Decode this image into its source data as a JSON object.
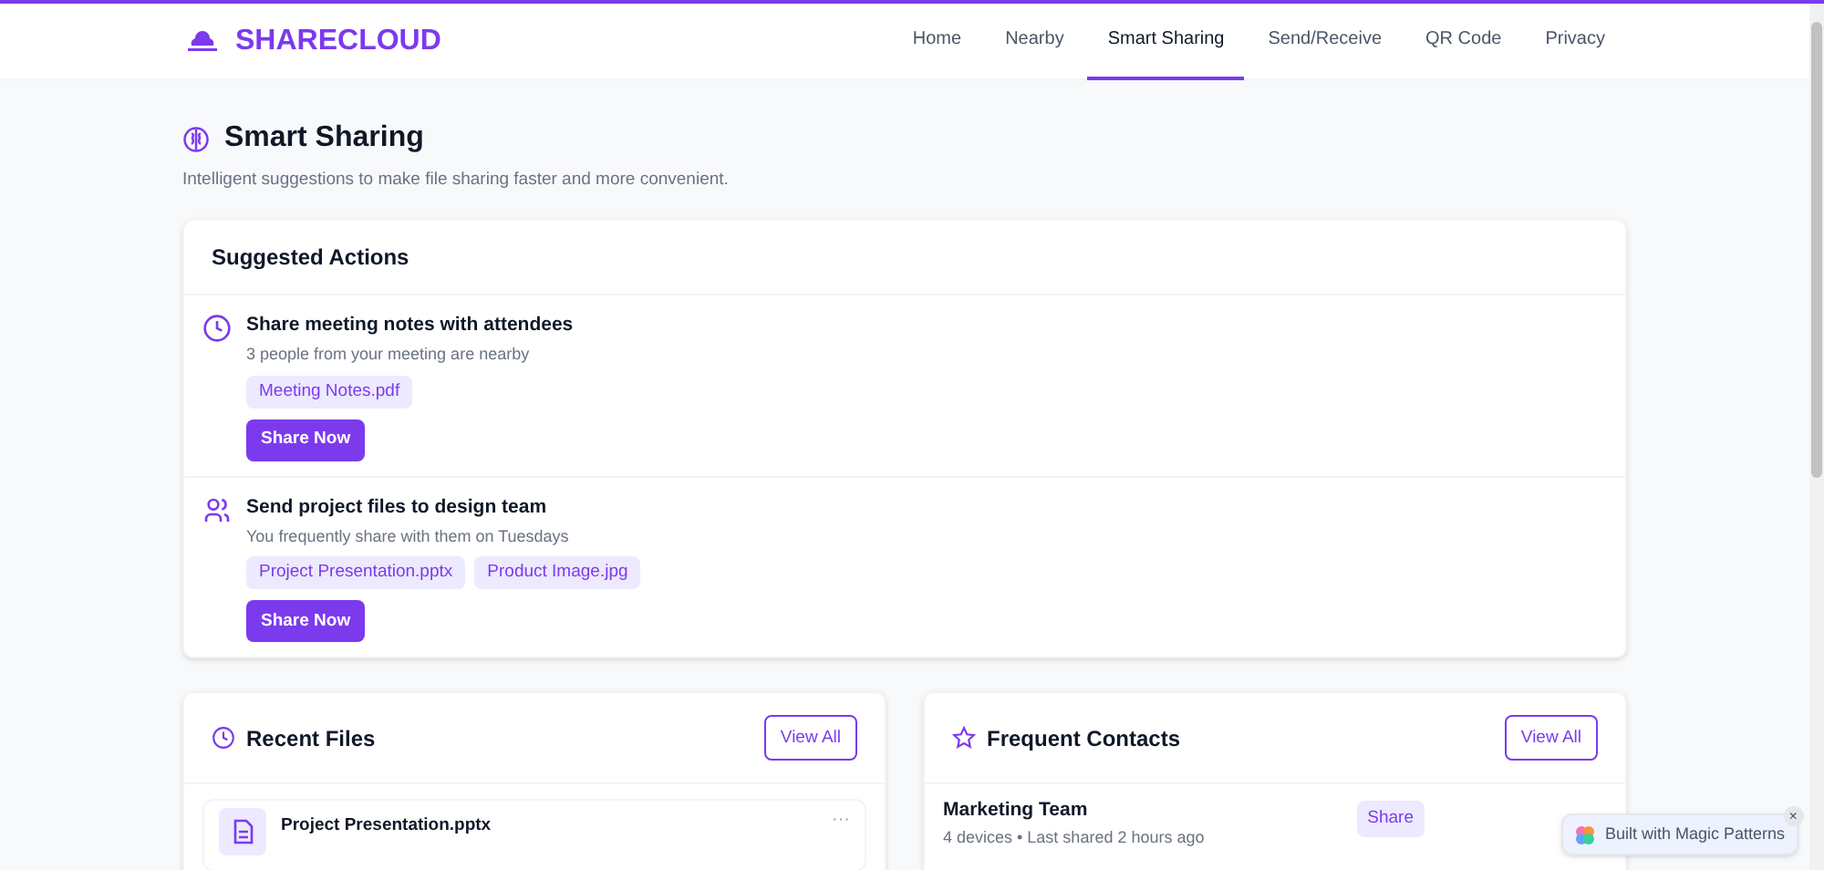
{
  "brand": "SHARECLOUD",
  "nav": [
    {
      "label": "Home",
      "selected": false
    },
    {
      "label": "Nearby",
      "selected": false
    },
    {
      "label": "Smart Sharing",
      "selected": true
    },
    {
      "label": "Send/Receive",
      "selected": false
    },
    {
      "label": "QR Code",
      "selected": false
    },
    {
      "label": "Privacy",
      "selected": false
    }
  ],
  "page": {
    "title": "Smart Sharing",
    "subtitle": "Intelligent suggestions to make file sharing faster and more convenient."
  },
  "suggested": {
    "title": "Suggested Actions",
    "actions": [
      {
        "kind": "clock",
        "title": "Share meeting notes with attendees",
        "subtitle": "3 people from your meeting are nearby",
        "files": [
          "Meeting Notes.pdf"
        ],
        "button": "Share Now"
      },
      {
        "kind": "people",
        "title": "Send project files to design team",
        "subtitle": "You frequently share with them on Tuesdays",
        "files": [
          "Project Presentation.pptx",
          "Product Image.jpg"
        ],
        "button": "Share Now"
      }
    ]
  },
  "recent_files": {
    "title": "Recent Files",
    "button": "View All",
    "files": [
      {
        "name": "Project Presentation.pptx",
        "menu": "···"
      }
    ]
  },
  "frequent_contacts": {
    "title": "Frequent Contacts",
    "button": "View All",
    "contacts": [
      {
        "name": "Marketing Team",
        "detail": "4 devices • Last shared 2 hours ago",
        "button": "Share"
      }
    ]
  },
  "badge": {
    "label": "Built with Magic Patterns",
    "close": "×"
  }
}
